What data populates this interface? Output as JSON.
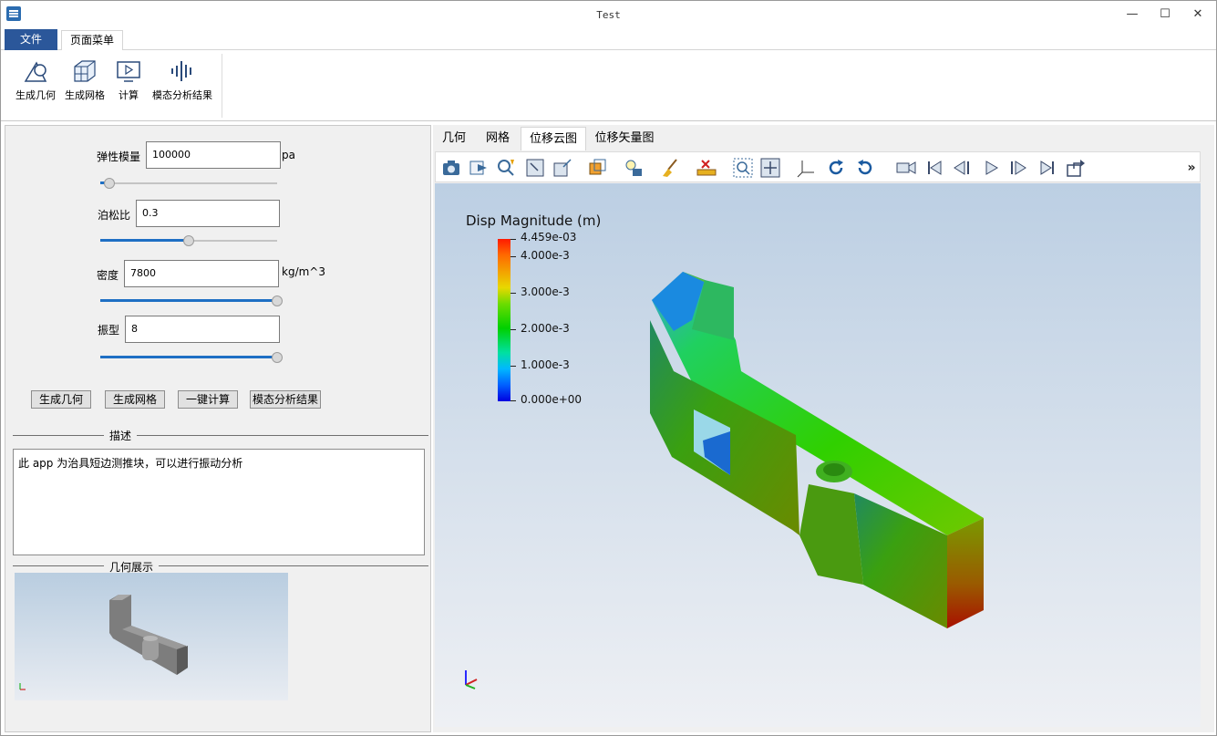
{
  "window": {
    "title": "Test",
    "min": "—",
    "max": "☐",
    "close": "✕"
  },
  "ribbon": {
    "tab_file": "文件",
    "tab_page": "页面菜单",
    "buttons": [
      {
        "label": "生成几何",
        "icon": "geometry-icon"
      },
      {
        "label": "生成网格",
        "icon": "mesh-icon"
      },
      {
        "label": "计算",
        "icon": "compute-icon"
      },
      {
        "label": "模态分析结果",
        "icon": "modal-result-icon"
      }
    ]
  },
  "params": {
    "elastic": {
      "label": "弹性模量",
      "value": "100000",
      "unit": "pa",
      "slider": 0.05
    },
    "poisson": {
      "label": "泊松比",
      "value": "0.3",
      "unit": "",
      "slider": 0.5
    },
    "density": {
      "label": "密度",
      "value": "7800",
      "unit": "kg/m^3",
      "slider": 1.0
    },
    "mode": {
      "label": "振型",
      "value": "8",
      "unit": "",
      "slider": 1.0
    }
  },
  "actions": [
    "生成几何",
    "生成网格",
    "一键计算",
    "模态分析结果"
  ],
  "description": {
    "title": "描述",
    "text": "此 app 为治具短边测推块，可以进行振动分析"
  },
  "geometry_preview": {
    "title": "几何展示"
  },
  "view_tabs": [
    "几何",
    "网格",
    "位移云图",
    "位移矢量图"
  ],
  "active_view_tab": 2,
  "colorbar": {
    "title": "Disp Magnitude (m)",
    "labels": [
      "4.459e-03",
      "4.000e-3",
      "3.000e-3",
      "2.000e-3",
      "1.000e-3",
      "0.000e+00"
    ]
  },
  "toolbar_icons": [
    "camera-icon",
    "export-icon",
    "pick-icon",
    "zoom-box-icon",
    "fit-icon",
    "view-cube-icon",
    "light-icon",
    "clear-icon",
    "ruler-icon",
    "zoom-select-icon",
    "center-icon",
    "axes-icon",
    "rotate-cw-icon",
    "rotate-ccw-icon",
    "record-icon",
    "first-frame-icon",
    "prev-frame-icon",
    "play-icon",
    "next-frame-icon",
    "last-frame-icon",
    "share-icon"
  ],
  "toolbar_more": "»"
}
